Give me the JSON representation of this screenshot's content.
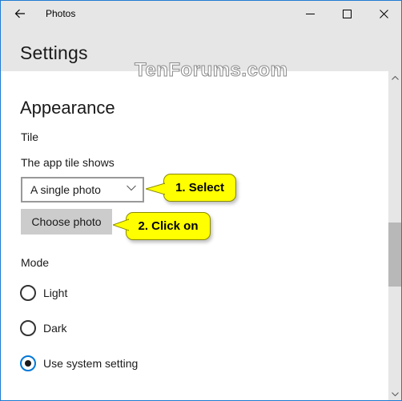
{
  "window": {
    "app_title": "Photos",
    "accent_color": "#1e7bd2",
    "controls": {
      "back": "back-arrow-icon",
      "minimize": "minimize-icon",
      "maximize": "maximize-icon",
      "close": "close-icon"
    }
  },
  "header": {
    "title": "Settings"
  },
  "watermark": "TenForums.com",
  "appearance": {
    "section_title": "Appearance",
    "tile": {
      "heading": "Tile",
      "label": "The app tile shows",
      "dropdown_value": "A single photo",
      "choose_button": "Choose photo"
    },
    "mode": {
      "heading": "Mode",
      "options": [
        {
          "label": "Light",
          "checked": false
        },
        {
          "label": "Dark",
          "checked": false
        },
        {
          "label": "Use system setting",
          "checked": true
        }
      ]
    }
  },
  "annotations": [
    {
      "text": "1. Select",
      "color": "#ffff00"
    },
    {
      "text": "2. Click on",
      "color": "#ffff00"
    }
  ],
  "scrollbar": {
    "position_fraction": 0.58
  }
}
